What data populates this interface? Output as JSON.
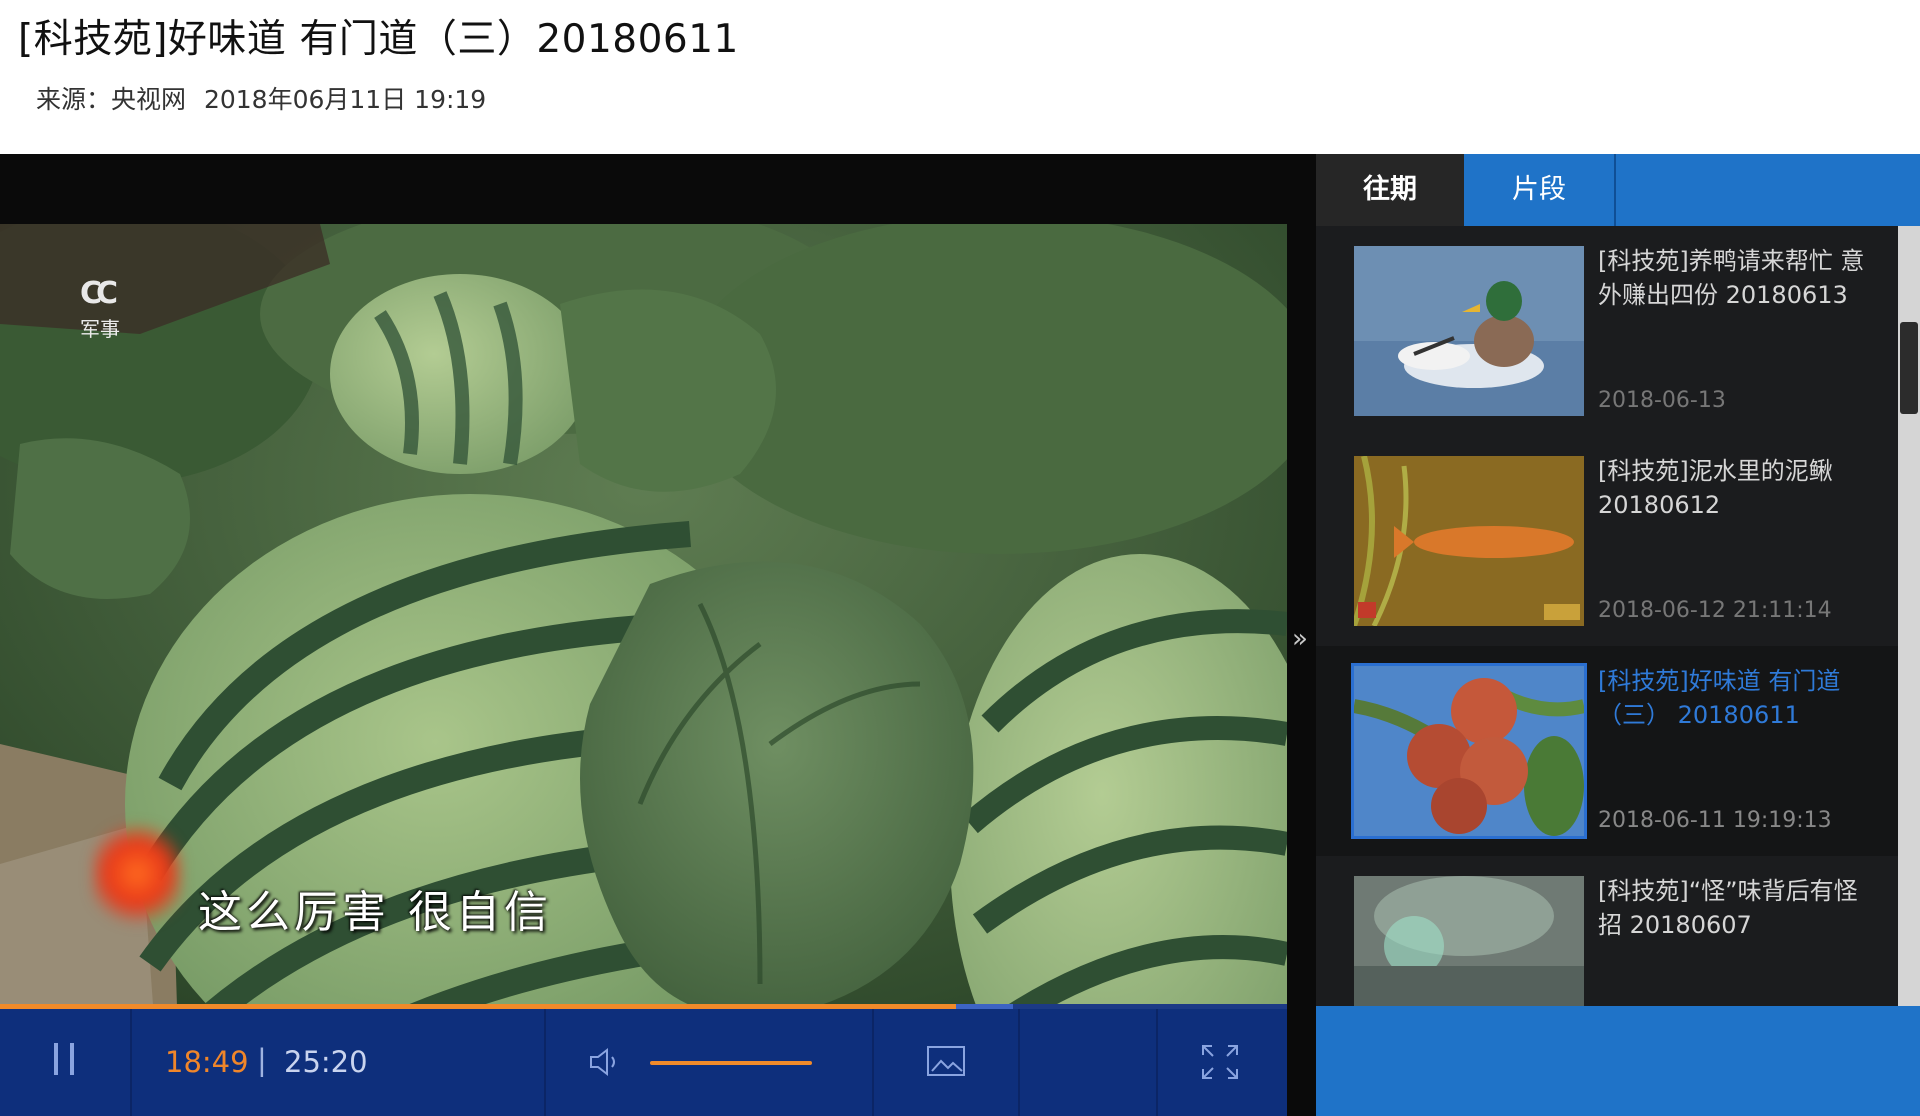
{
  "header": {
    "title": "[科技苑]好味道 有门道（三）20180611",
    "source_label": "来源：央视网",
    "publish_datetime": "2018年06月11日 19:19"
  },
  "player": {
    "channel_logo_text": "CC",
    "channel_logo_sub": "军事",
    "subtitle": "这么厉害 很自信",
    "expand_glyph": "»",
    "time_current": "18:49",
    "time_separator": "|",
    "time_total": "25:20",
    "progress_fraction": 0.743,
    "buffered_fraction": 0.787,
    "volume_fraction": 1.0,
    "icons": {
      "pause": "pause-icon",
      "volume": "volume-icon",
      "quality": "hd-quality-icon",
      "fullscreen": "fullscreen-icon"
    }
  },
  "sidebar": {
    "tabs": [
      {
        "label": "往期",
        "active": true
      },
      {
        "label": "片段",
        "active": false
      }
    ],
    "items": [
      {
        "title": "[科技苑]养鸭请来帮忙 意外赚出四份 20180613",
        "date": "2018-06-13",
        "thumb": "duck",
        "active": false
      },
      {
        "title": "[科技苑]泥水里的泥鳅 20180612",
        "date": "2018-06-12 21:11:14",
        "thumb": "loach",
        "active": false
      },
      {
        "title": "[科技苑]好味道 有门道（三） 20180611",
        "date": "2018-06-11 19:19:13",
        "thumb": "lychee",
        "active": true
      },
      {
        "title": "[科技苑]“怪”味背后有怪招 20180607",
        "date": "",
        "thumb": "water",
        "active": false
      }
    ]
  },
  "colors": {
    "accent_orange": "#f08a2a",
    "control_bar_blue": "#0e2f7c",
    "sidebar_blue": "#1f73c8",
    "active_title_blue": "#2f7ad8"
  }
}
